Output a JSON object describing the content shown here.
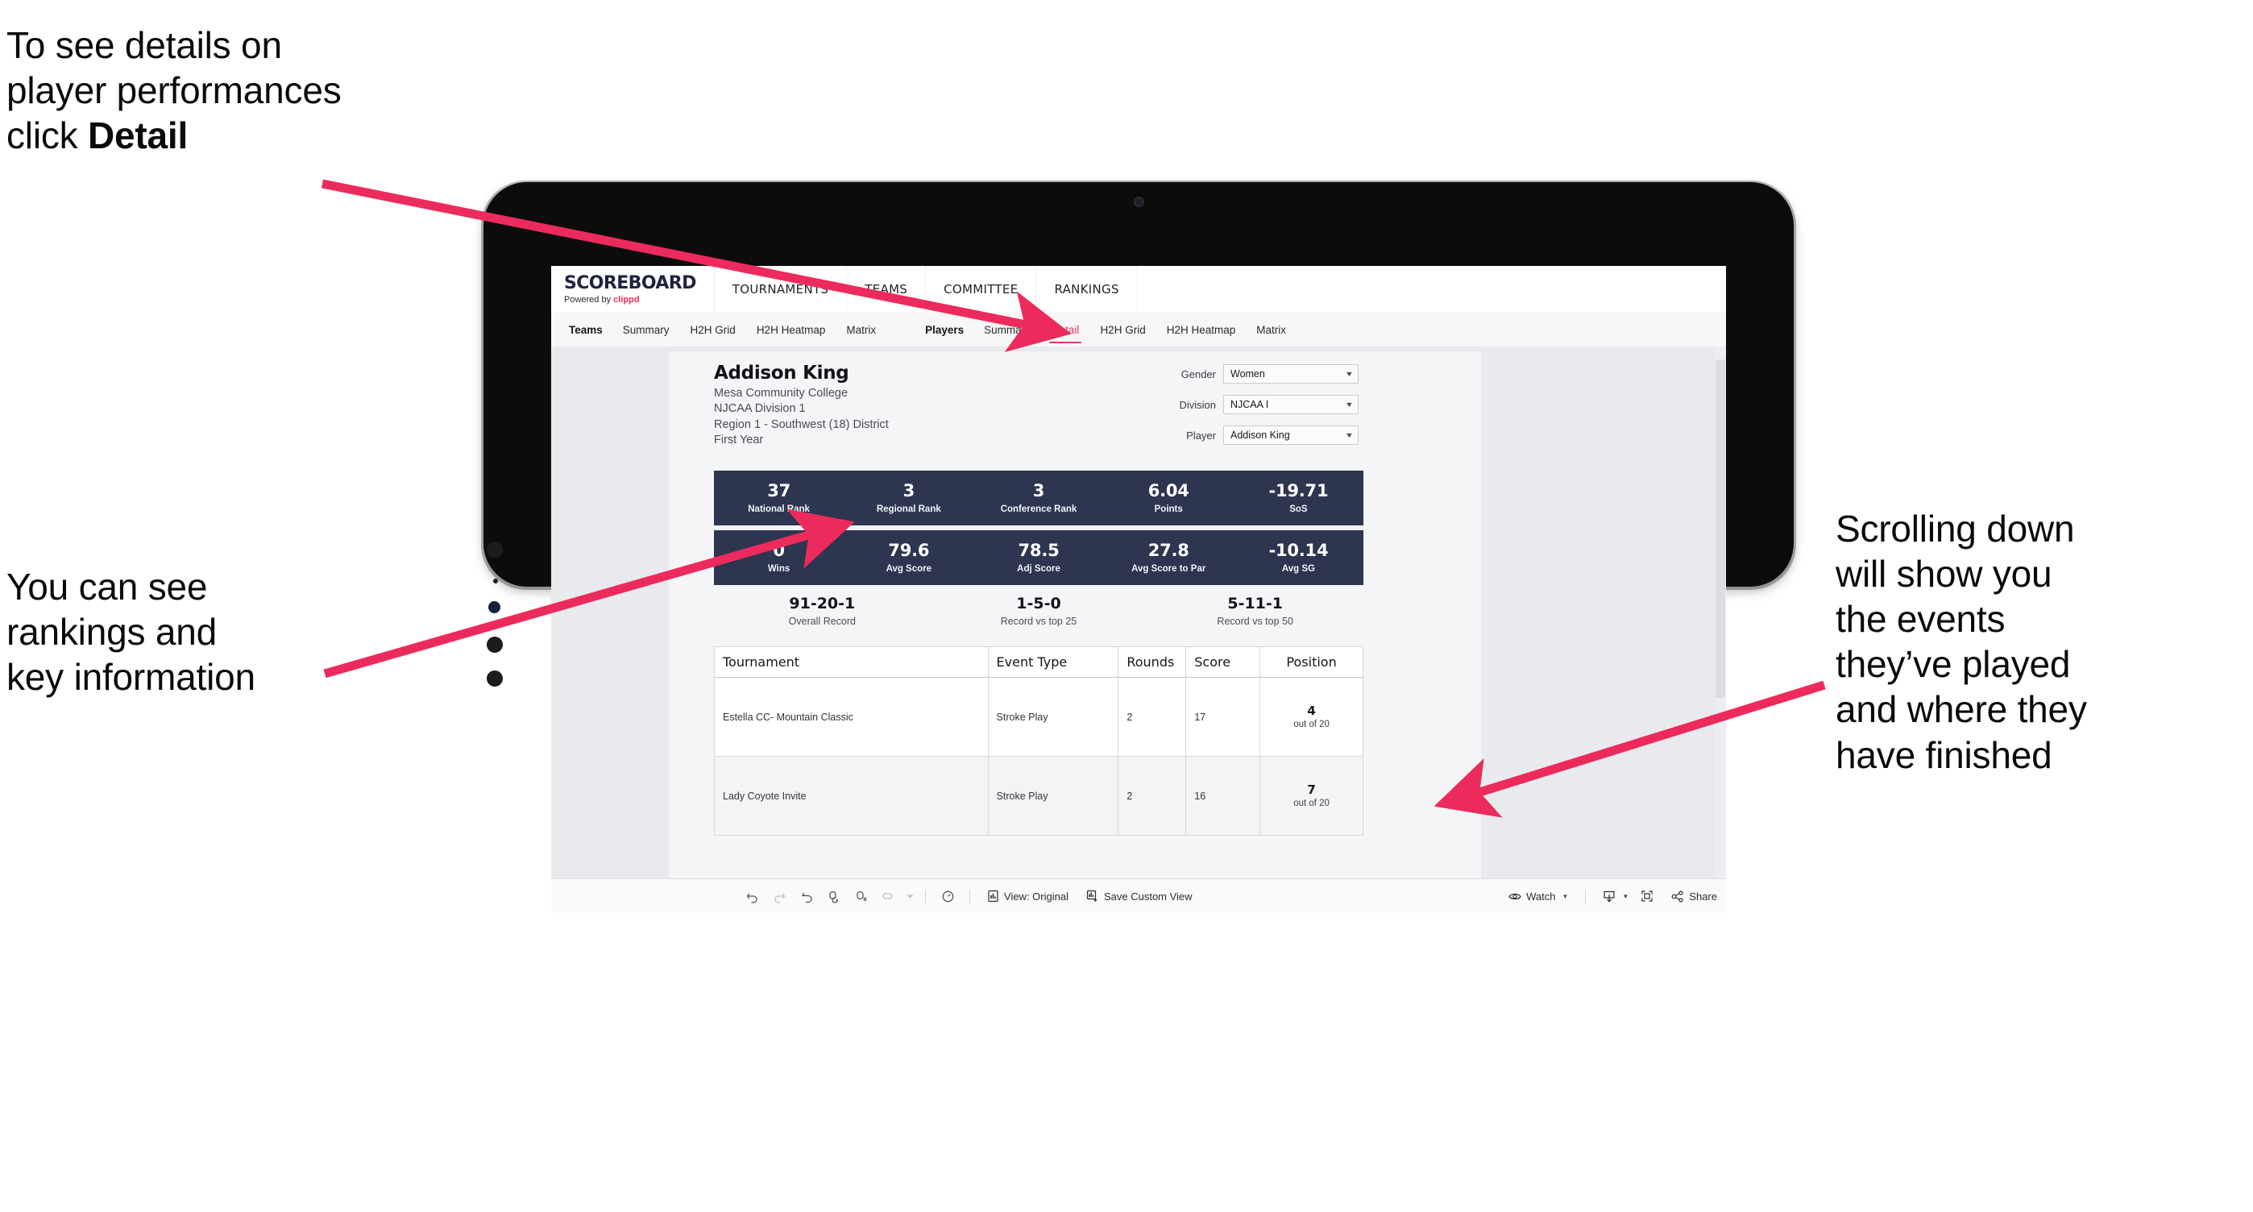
{
  "annotations": {
    "detail_note": {
      "line1": "To see details on",
      "line2": "player performances",
      "line3_prefix": "click ",
      "line3_bold": "Detail"
    },
    "rankings_note": {
      "line1": "You can see",
      "line2": "rankings and",
      "line3": "key information"
    },
    "scroll_note": {
      "line1": "Scrolling down",
      "line2": "will show you",
      "line3": "the events",
      "line4": "they’ve played",
      "line5": "and where they",
      "line6": "have finished"
    },
    "arrow_color": "#ec2b5c"
  },
  "app": {
    "brand": {
      "title": "SCOREBOARD",
      "powered_prefix": "Powered by ",
      "powered_name": "clippd"
    },
    "topnav": [
      {
        "label": "TOURNAMENTS"
      },
      {
        "label": "TEAMS"
      },
      {
        "label": "COMMITTEE"
      },
      {
        "label": "RANKINGS"
      }
    ],
    "tabs": {
      "teams_label": "Teams",
      "teams_items": [
        {
          "label": "Summary",
          "active": false
        },
        {
          "label": "H2H Grid",
          "active": false
        },
        {
          "label": "H2H Heatmap",
          "active": false
        },
        {
          "label": "Matrix",
          "active": false
        }
      ],
      "players_label": "Players",
      "players_items": [
        {
          "label": "Summary",
          "active": false
        },
        {
          "label": "Detail",
          "active": true
        },
        {
          "label": "H2H Grid",
          "active": false
        },
        {
          "label": "H2H Heatmap",
          "active": false
        },
        {
          "label": "Matrix",
          "active": false
        }
      ],
      "active_tab": "Detail",
      "active_color": "#e03a62"
    }
  },
  "player": {
    "name": "Addison King",
    "school": "Mesa Community College",
    "division": "NJCAA Division 1",
    "region": "Region 1 - Southwest (18) District",
    "class_year": "First Year"
  },
  "filters": [
    {
      "label": "Gender",
      "value": "Women"
    },
    {
      "label": "Division",
      "value": "NJCAA I"
    },
    {
      "label": "Player",
      "value": "Addison King"
    }
  ],
  "stat_bands": {
    "band_color": "#2e3550",
    "row1": [
      {
        "value": "37",
        "label": "National Rank"
      },
      {
        "value": "3",
        "label": "Regional Rank"
      },
      {
        "value": "3",
        "label": "Conference Rank"
      },
      {
        "value": "6.04",
        "label": "Points"
      },
      {
        "value": "-19.71",
        "label": "SoS"
      }
    ],
    "row2": [
      {
        "value": "0",
        "label": "Wins"
      },
      {
        "value": "79.6",
        "label": "Avg Score"
      },
      {
        "value": "78.5",
        "label": "Adj Score"
      },
      {
        "value": "27.8",
        "label": "Avg Score to Par"
      },
      {
        "value": "-10.14",
        "label": "Avg SG"
      }
    ]
  },
  "records": [
    {
      "value": "91-20-1",
      "label": "Overall Record"
    },
    {
      "value": "1-5-0",
      "label": "Record vs top 25"
    },
    {
      "value": "5-11-1",
      "label": "Record vs top 50"
    }
  ],
  "events_table": {
    "columns": [
      "Tournament",
      "Event Type",
      "Rounds",
      "Score",
      "Position"
    ],
    "rows": [
      {
        "tournament": "Estella CC- Mountain Classic",
        "event_type": "Stroke Play",
        "rounds": "2",
        "score": "17",
        "position": "4",
        "position_sub": "out of 20"
      },
      {
        "tournament": "Lady Coyote Invite",
        "event_type": "Stroke Play",
        "rounds": "2",
        "score": "16",
        "position": "7",
        "position_sub": "out of 20"
      }
    ]
  },
  "toolbar": {
    "icons": [
      "undo-icon",
      "redo-icon",
      "revert-icon",
      "refresh-icon",
      "pause-icon",
      "highlight-icon"
    ],
    "view_label": "View: Original",
    "save_label": "Save Custom View",
    "watch_label": "Watch",
    "share_label": "Share"
  }
}
